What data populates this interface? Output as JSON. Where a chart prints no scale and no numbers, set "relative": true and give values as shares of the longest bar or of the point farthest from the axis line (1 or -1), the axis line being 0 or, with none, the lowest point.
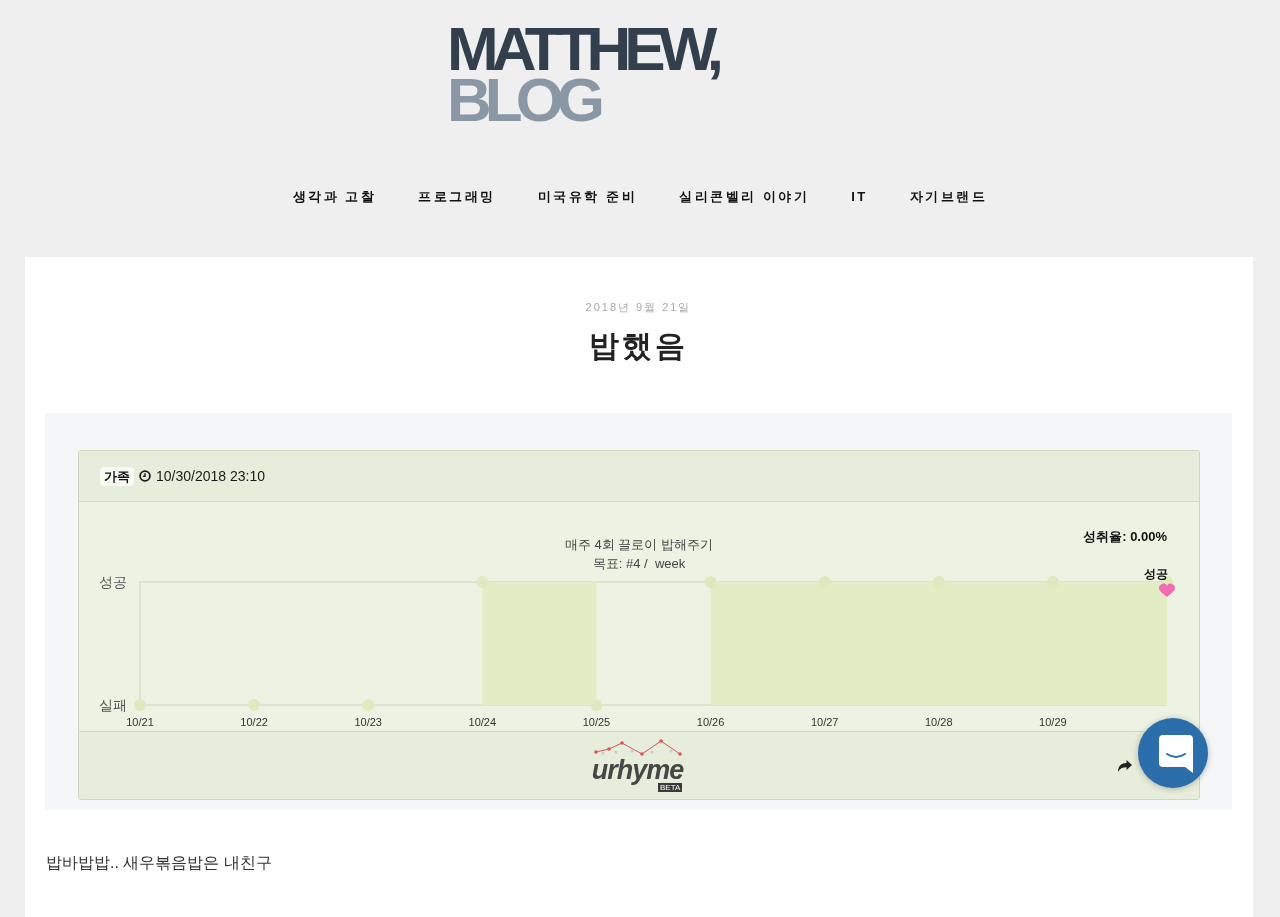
{
  "logo": {
    "line_1": "MATTHEW,",
    "line_2": "BLOG"
  },
  "nav": [
    "생각과 고찰",
    "프로그래밍",
    "미국유학 준비",
    "실리콘벨리 이야기",
    "IT",
    "자기브랜드"
  ],
  "post": {
    "date": "2018년 9월 21일",
    "title": "밥했음",
    "body": "밥바밥밥.. 새우볶음밥은 내친구"
  },
  "widget": {
    "tag": "가족",
    "timestamp": "10/30/2018 23:10",
    "chart": {
      "achievement": "성취율: 0.00%",
      "goal": "목표: #4 /  week",
      "y_axis_labels": [
        "성공",
        "실패"
      ],
      "chart_data": {
        "type": "area",
        "title": "매주 4회 끌로이 밥해주기",
        "categories": [
          "10/21",
          "10/22",
          "10/23",
          "10/24",
          "10/25",
          "10/26",
          "10/27",
          "10/28",
          "10/29",
          null
        ],
        "series": [
          {
            "color": "#e2edc6",
            "values": [
              0,
              0,
              0,
              1,
              0,
              1,
              1,
              1,
              1,
              1
            ]
          }
        ],
        "relative": true,
        "annotations": [
          {
            "text": "성공"
          }
        ]
      }
    },
    "footer": {
      "logo": "urhyme",
      "logo_badge": "BETA"
    }
  }
}
